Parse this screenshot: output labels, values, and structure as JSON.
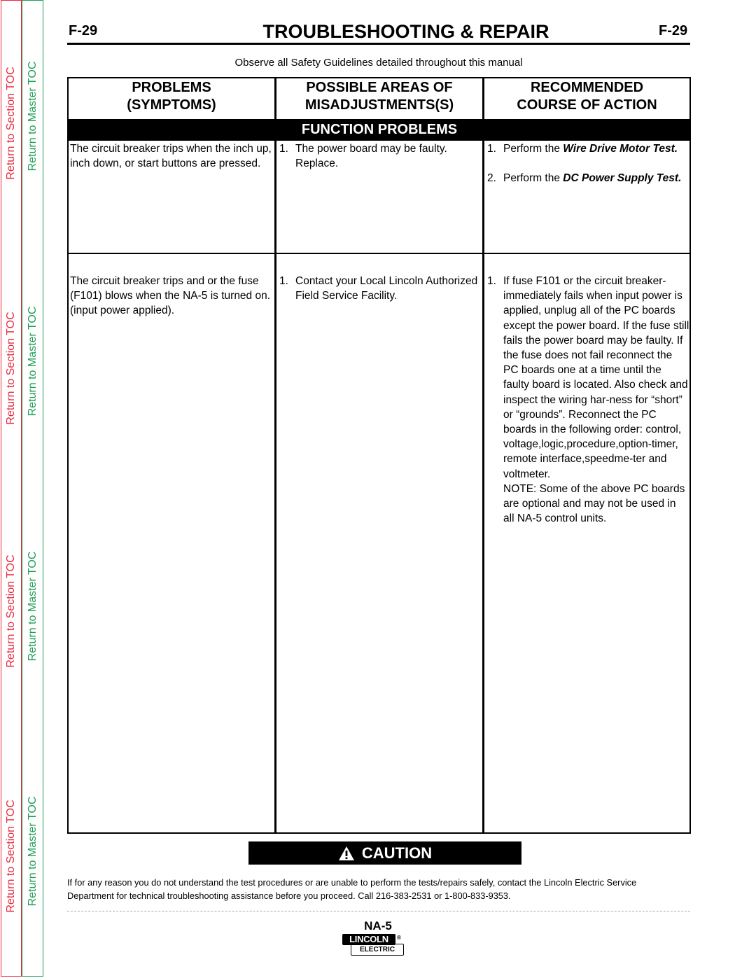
{
  "sidebar": {
    "section_toc_label": "Return to Section TOC",
    "master_toc_label": "Return to Master TOC",
    "section_color": "#e8283c",
    "master_color": "#1e9e55"
  },
  "header": {
    "page_number_left": "F-29",
    "page_number_right": "F-29",
    "title": "TROUBLESHOOTING & REPAIR",
    "safety_note": "Observe all Safety Guidelines detailed throughout this manual"
  },
  "table": {
    "columns": [
      {
        "line1": "PROBLEMS",
        "line2": "(SYMPTOMS)"
      },
      {
        "line1": "POSSIBLE AREAS OF",
        "line2": "MISADJUSTMENTS(S)"
      },
      {
        "line1": "RECOMMENDED",
        "line2": "COURSE OF ACTION"
      }
    ],
    "section_title": "FUNCTION PROBLEMS",
    "rows": [
      {
        "problem": "The circuit breaker trips when the inch up, inch down, or start buttons are pressed.",
        "causes": [
          {
            "num": "1.",
            "text": "The power board may be faulty. Replace."
          }
        ],
        "actions": [
          {
            "num": "1.",
            "prefix": "Perform the ",
            "emph": "Wire Drive Motor Test."
          },
          {
            "num": "2.",
            "prefix": "Perform the ",
            "emph": "DC Power Supply Test."
          }
        ]
      },
      {
        "problem": "The circuit breaker trips and or the fuse (F101) blows when the NA-5 is turned on. (input power applied).",
        "causes": [
          {
            "num": "1.",
            "text": "Contact your Local Lincoln Authorized Field Service Facility."
          }
        ],
        "actions": [
          {
            "num": "1.",
            "text": "If fuse F101 or the circuit breaker-immediately fails when input power is applied,   unplug all of the PC boards except the power board.  If the fuse still fails the power board may be faulty.   If the fuse does not fail reconnect the PC boards one at a time until the faulty board is located.  Also check and inspect the wiring har-ness for “short” or “grounds”. Reconnect the PC boards in the following order:  control, voltage,logic,procedure,option-timer, remote interface,speedme-ter and voltmeter.",
            "note": "NOTE:  Some of the above PC boards are optional and may not be used in all NA-5 control units."
          }
        ]
      }
    ]
  },
  "caution": {
    "label": "CAUTION",
    "icon": "warning-triangle-icon",
    "text": "If for any reason you do not understand the test procedures or are unable to perform the tests/repairs safely, contact the Lincoln Electric Service Department for technical troubleshooting assistance before you proceed. Call 216-383-2531 or 1-800-833-9353."
  },
  "footer": {
    "model": "NA-5",
    "logo_top": "LINCOLN",
    "logo_bottom": "ELECTRIC",
    "logo_reg": "®"
  }
}
